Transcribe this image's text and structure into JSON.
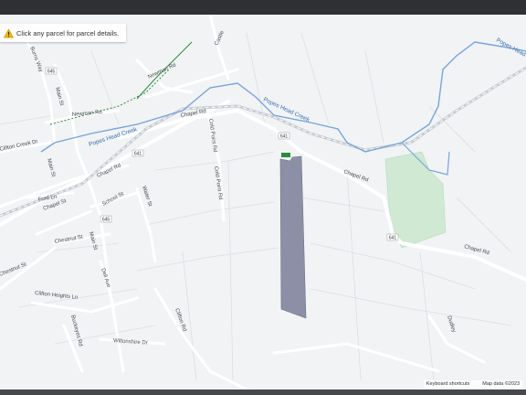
{
  "banner": {
    "text": "Click any parcel for parcel details."
  },
  "attribution": {
    "shortcuts": "Keyboard shortcuts",
    "map_data": "Map data ©2023"
  },
  "labels": {
    "castle": "Castle",
    "popes_head_creek_1": "Popes Head Creek",
    "popes_head_creek_2": "Popes Head Creek",
    "popes_head_creek_3": "Popes Head Creek",
    "chapel_rd_1": "Chapel Rd",
    "chapel_rd_2": "Chapel Rd",
    "chapel_rd_3": "Chapel Rd",
    "chapel_rd_4": "Chapel Rd",
    "chapel_st": "Chapel St",
    "newman_rd_1": "Newman Rd",
    "newman_rd_2": "Newman Rd",
    "main_st_1": "Main St",
    "main_st_2": "Main St",
    "main_st_3": "Main St",
    "burns_way": "Burns Way",
    "clifton_creek_dr": "Clifton Creek Dr",
    "ford_ln": "Ford Ln",
    "school_st": "School St",
    "water_st": "Water St",
    "chestnut_st_1": "Chestnut St",
    "chestnut_st_2": "Chestnut St",
    "cold_point_rd_1": "Cold Point Rd",
    "cold_point_rd_2": "Cold Point Rd",
    "dell_ave": "Dell Ave",
    "clifton_heights_ln": "Clifton Heights Ln",
    "buckeyes_rd": "Buckeyes Rd",
    "wiltonshire_dr": "Wiltonshire Dr",
    "clifton_rd": "Clifton Rd",
    "dudley": "Dudley"
  },
  "shields": {
    "s1": "645",
    "s2": "641",
    "s3": "641",
    "s4": "645",
    "s5": "641"
  },
  "colors": {
    "parcel_fill": "#8c8fa5",
    "park_fill": "#cfe9d3",
    "water": "#79a5d6",
    "marker": "#2e8b3a"
  }
}
